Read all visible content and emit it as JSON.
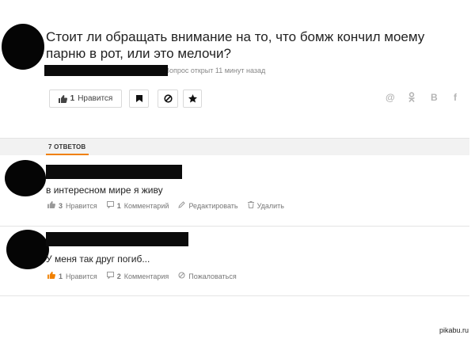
{
  "question": {
    "title": "Стоит ли обращать внимание на то, что бомж кончил моему парню в рот, или это мелочи?",
    "open_time": "Вопрос открыт 11 минут назад",
    "like_count": "1",
    "like_label": "Нравится"
  },
  "share": {
    "mail": "@",
    "ok": "ok",
    "vk": "B",
    "fb": "f"
  },
  "answers_header": {
    "label": "7 ОТВЕТОВ"
  },
  "answers": [
    {
      "text": "в интересном мире я живу",
      "likes": "3",
      "like_label": "Нравится",
      "comments": "1",
      "comments_label": "Комментарий",
      "edit_label": "Редактировать",
      "delete_label": "Удалить"
    },
    {
      "text": "У меня так друг погиб...",
      "likes": "1",
      "like_label": "Нравится",
      "comments": "2",
      "comments_label": "Комментария",
      "report_label": "Пожаловаться"
    }
  ],
  "watermark": "pikabu.ru",
  "colors": {
    "accent": "#f08000",
    "header_bg": "#f2f2f2",
    "divider": "#e4e4e4"
  }
}
